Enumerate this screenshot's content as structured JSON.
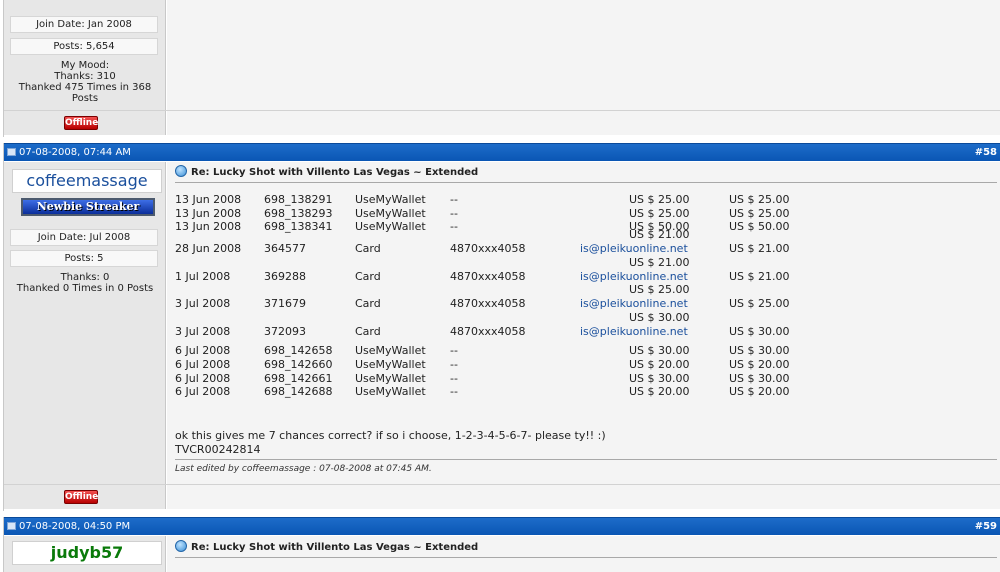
{
  "prev_post": {
    "join_date": "Join Date: Jan 2008",
    "posts": "Posts: 5,654",
    "mood": "My Mood:",
    "thanks": "Thanks: 310",
    "thanked": "Thanked 475 Times in 368",
    "thanked2": "Posts",
    "offline_label": "Offline"
  },
  "post58": {
    "date": "07-08-2008, 07:44 AM",
    "number": "#58",
    "username": "coffeemassage",
    "rank": "Newbie Streaker",
    "join_date": "Join Date: Jul 2008",
    "posts": "Posts: 5",
    "thanks": "Thanks: 0",
    "thanked": "Thanked 0 Times in 0 Posts",
    "title": "Re: Lucky Shot with Villento Las Vegas ~ Extended",
    "transactions": [
      {
        "date": "13 Jun 2008",
        "id": "698_138291",
        "method": "UseMyWallet",
        "account": "--",
        "amount": "US $ 25.00",
        "total": "US $ 25.00",
        "email": ""
      },
      {
        "date": "13 Jun 2008",
        "id": "698_138293",
        "method": "UseMyWallet",
        "account": "--",
        "amount": "US $ 25.00",
        "total": "US $ 25.00",
        "email": ""
      },
      {
        "date": "13 Jun 2008",
        "id": "698_138341",
        "method": "UseMyWallet",
        "account": "--",
        "amount": "US $ 50.00",
        "total": "US $ 50.00",
        "email": ""
      },
      {
        "date": "28 Jun 2008",
        "id": "364577",
        "method": "Card",
        "account": "4870xxx4058",
        "amount": "US $ 21.00",
        "total": "US $ 21.00",
        "email": "is@pleikuonline.net"
      },
      {
        "date": "1 Jul 2008",
        "id": "369288",
        "method": "Card",
        "account": "4870xxx4058",
        "amount": "US $ 21.00",
        "total": "US $ 21.00",
        "email": "is@pleikuonline.net"
      },
      {
        "date": "3 Jul 2008",
        "id": "371679",
        "method": "Card",
        "account": "4870xxx4058",
        "amount": "US $ 25.00",
        "total": "US $ 25.00",
        "email": "is@pleikuonline.net"
      },
      {
        "date": "3 Jul 2008",
        "id": "372093",
        "method": "Card",
        "account": "4870xxx4058",
        "amount": "US $ 30.00",
        "total": "US $ 30.00",
        "email": "is@pleikuonline.net"
      },
      {
        "date": "6 Jul 2008",
        "id": "698_142658",
        "method": "UseMyWallet",
        "account": "--",
        "amount": "US $ 30.00",
        "total": "US $ 30.00",
        "email": ""
      },
      {
        "date": "6 Jul 2008",
        "id": "698_142660",
        "method": "UseMyWallet",
        "account": "--",
        "amount": "US $ 20.00",
        "total": "US $ 20.00",
        "email": ""
      },
      {
        "date": "6 Jul 2008",
        "id": "698_142661",
        "method": "UseMyWallet",
        "account": "--",
        "amount": "US $ 30.00",
        "total": "US $ 30.00",
        "email": ""
      },
      {
        "date": "6 Jul 2008",
        "id": "698_142688",
        "method": "UseMyWallet",
        "account": "--",
        "amount": "US $ 20.00",
        "total": "US $ 20.00",
        "email": ""
      }
    ],
    "message": "ok this gives me 7 chances correct? if so i choose, 1-2-3-4-5-6-7- please ty!! :)",
    "code": "TVCR00242814",
    "edited": "Last edited by coffeemassage : 07-08-2008 at 07:45 AM.",
    "offline_label": "Offline"
  },
  "post59": {
    "date": "07-08-2008, 04:50 PM",
    "number": "#59",
    "username": "judyb57",
    "title": "Re: Lucky Shot with Villento Las Vegas ~ Extended"
  },
  "colors": {
    "header_blue": "#0a56b4",
    "username_blue": "#1a4f9c",
    "username_green": "#0a7a0a",
    "offline_red": "#cc0000"
  }
}
